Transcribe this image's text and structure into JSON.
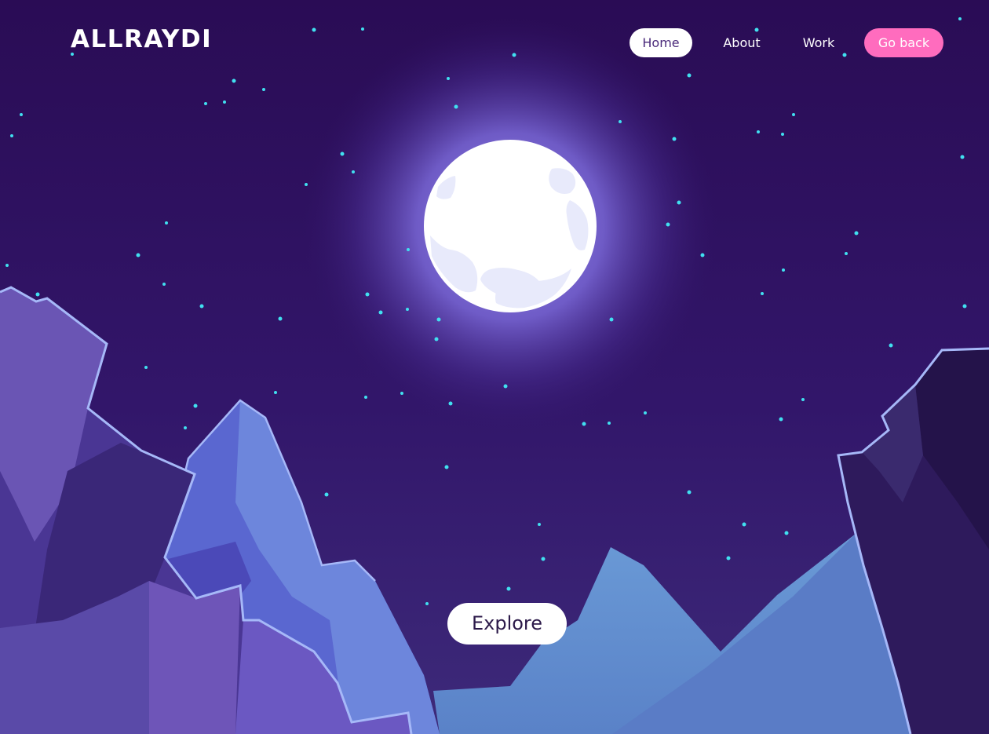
{
  "brand": {
    "logo_text": "ALLRAYDI"
  },
  "nav": {
    "items": [
      {
        "label": "Home",
        "active": true
      },
      {
        "label": "About"
      },
      {
        "label": "Work"
      },
      {
        "label": "Go back",
        "accent": true
      }
    ]
  },
  "hero": {
    "cta_label": "Explore"
  },
  "colors": {
    "sky_top": "#2a0c55",
    "sky_bottom": "#3d2a7a",
    "moon": "#ffffff",
    "moon_glow": "#8c7ce8",
    "star": "#41e0f0",
    "accent_pink": "#ff6cbe",
    "home_text": "#4a2a7a"
  }
}
